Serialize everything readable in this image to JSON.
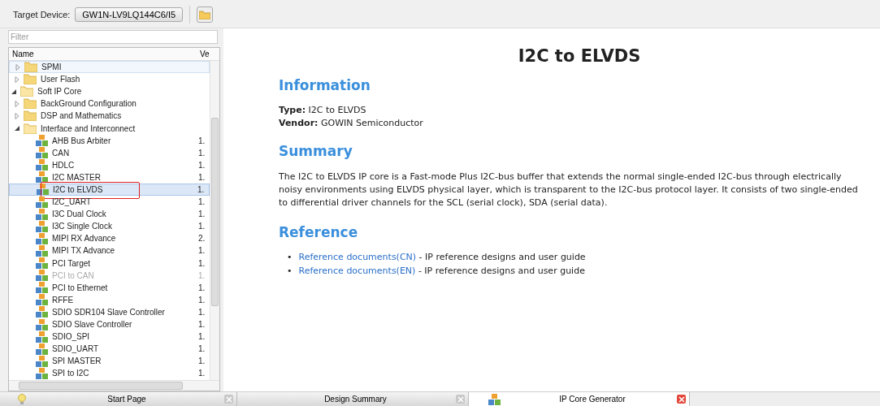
{
  "toolbar": {
    "label": "Target Device:",
    "device": "GW1N-LV9LQ144C6/I5"
  },
  "filter": {
    "placeholder": "Filter"
  },
  "tree_columns": [
    "Name",
    "Ve"
  ],
  "tree": [
    {
      "kind": "hidden",
      "children": [
        {
          "kind": "folder",
          "label": "SPMI",
          "expanded": false,
          "selected": false,
          "hovered": true
        },
        {
          "kind": "folder",
          "label": "User Flash",
          "expanded": false,
          "selected": false
        }
      ]
    },
    {
      "kind": "folder",
      "label": "Soft IP Core",
      "expanded": true,
      "selected": false,
      "children": [
        {
          "kind": "folder",
          "label": "BackGround Configuration",
          "expanded": false,
          "selected": false
        },
        {
          "kind": "folder",
          "label": "DSP and Mathematics",
          "expanded": false,
          "selected": false
        },
        {
          "kind": "folder",
          "label": "Interface and Interconnect",
          "expanded": true,
          "selected": false,
          "children": [
            {
              "kind": "ip",
              "label": "AHB Bus Arbiter",
              "version": "1.",
              "selected": false,
              "disabled": false
            },
            {
              "kind": "ip",
              "label": "CAN",
              "version": "1.",
              "selected": false,
              "disabled": false
            },
            {
              "kind": "ip",
              "label": "HDLC",
              "version": "1.",
              "selected": false,
              "disabled": false
            },
            {
              "kind": "ip",
              "label": "I2C MASTER",
              "version": "1.",
              "selected": false,
              "disabled": false
            },
            {
              "kind": "ip",
              "label": "I2C to ELVDS",
              "version": "1.",
              "selected": true,
              "disabled": false,
              "annotated": true
            },
            {
              "kind": "ip",
              "label": "I2C_UART",
              "version": "1.",
              "selected": false,
              "disabled": false
            },
            {
              "kind": "ip",
              "label": "I3C Dual Clock",
              "version": "1.",
              "selected": false,
              "disabled": false
            },
            {
              "kind": "ip",
              "label": "I3C Single Clock",
              "version": "1.",
              "selected": false,
              "disabled": false
            },
            {
              "kind": "ip",
              "label": "MIPI RX Advance",
              "version": "2.",
              "selected": false,
              "disabled": false
            },
            {
              "kind": "ip",
              "label": "MIPI TX Advance",
              "version": "1.",
              "selected": false,
              "disabled": false
            },
            {
              "kind": "ip",
              "label": "PCI Target",
              "version": "1.",
              "selected": false,
              "disabled": false
            },
            {
              "kind": "ip",
              "label": "PCI to CAN",
              "version": "1.",
              "selected": false,
              "disabled": true
            },
            {
              "kind": "ip",
              "label": "PCI to Ethernet",
              "version": "1.",
              "selected": false,
              "disabled": false
            },
            {
              "kind": "ip",
              "label": "RFFE",
              "version": "1.",
              "selected": false,
              "disabled": false
            },
            {
              "kind": "ip",
              "label": "SDIO SDR104 Slave Controller",
              "version": "1.",
              "selected": false,
              "disabled": false
            },
            {
              "kind": "ip",
              "label": "SDIO Slave Controller",
              "version": "1.",
              "selected": false,
              "disabled": false
            },
            {
              "kind": "ip",
              "label": "SDIO_SPI",
              "version": "1.",
              "selected": false,
              "disabled": false
            },
            {
              "kind": "ip",
              "label": "SDIO_UART",
              "version": "1.",
              "selected": false,
              "disabled": false
            },
            {
              "kind": "ip",
              "label": "SPI MASTER",
              "version": "1.",
              "selected": false,
              "disabled": false
            },
            {
              "kind": "ip",
              "label": "SPI to I2C",
              "version": "1.",
              "selected": false,
              "disabled": false
            }
          ]
        }
      ]
    }
  ],
  "doc": {
    "title": "I2C to ELVDS",
    "sections": [
      {
        "kind": "info",
        "heading": "Information",
        "lines": [
          "**Type:** I2C to ELVDS",
          "**Vendor:** GOWIN Semiconductor"
        ]
      },
      {
        "kind": "text",
        "heading": "Summary",
        "text": "The I2C to ELVDS IP core is a Fast-mode Plus I2C-bus buffer that extends the normal single-ended I2C-bus through electrically noisy environments using ELVDS physical layer, which is transparent to the I2C-bus protocol layer. It consists of two single-ended to differential driver channels for the SCL (serial clock), SDA (serial data)."
      },
      {
        "kind": "links",
        "heading": "Reference",
        "links": [
          {
            "bullet": "•",
            "link": "Reference documents(CN)",
            "rest": " - IP reference designs and user guide"
          },
          {
            "bullet": "•",
            "link": "Reference documents(EN)",
            "rest": " - IP reference designs and user guide"
          }
        ]
      }
    ]
  },
  "tabs": [
    {
      "label": "Start Page",
      "kind": "start",
      "selected": false
    },
    {
      "label": "Design Summary",
      "kind": "summary",
      "selected": false
    },
    {
      "label": "IP Core Generator",
      "kind": "generator",
      "selected": true
    }
  ]
}
